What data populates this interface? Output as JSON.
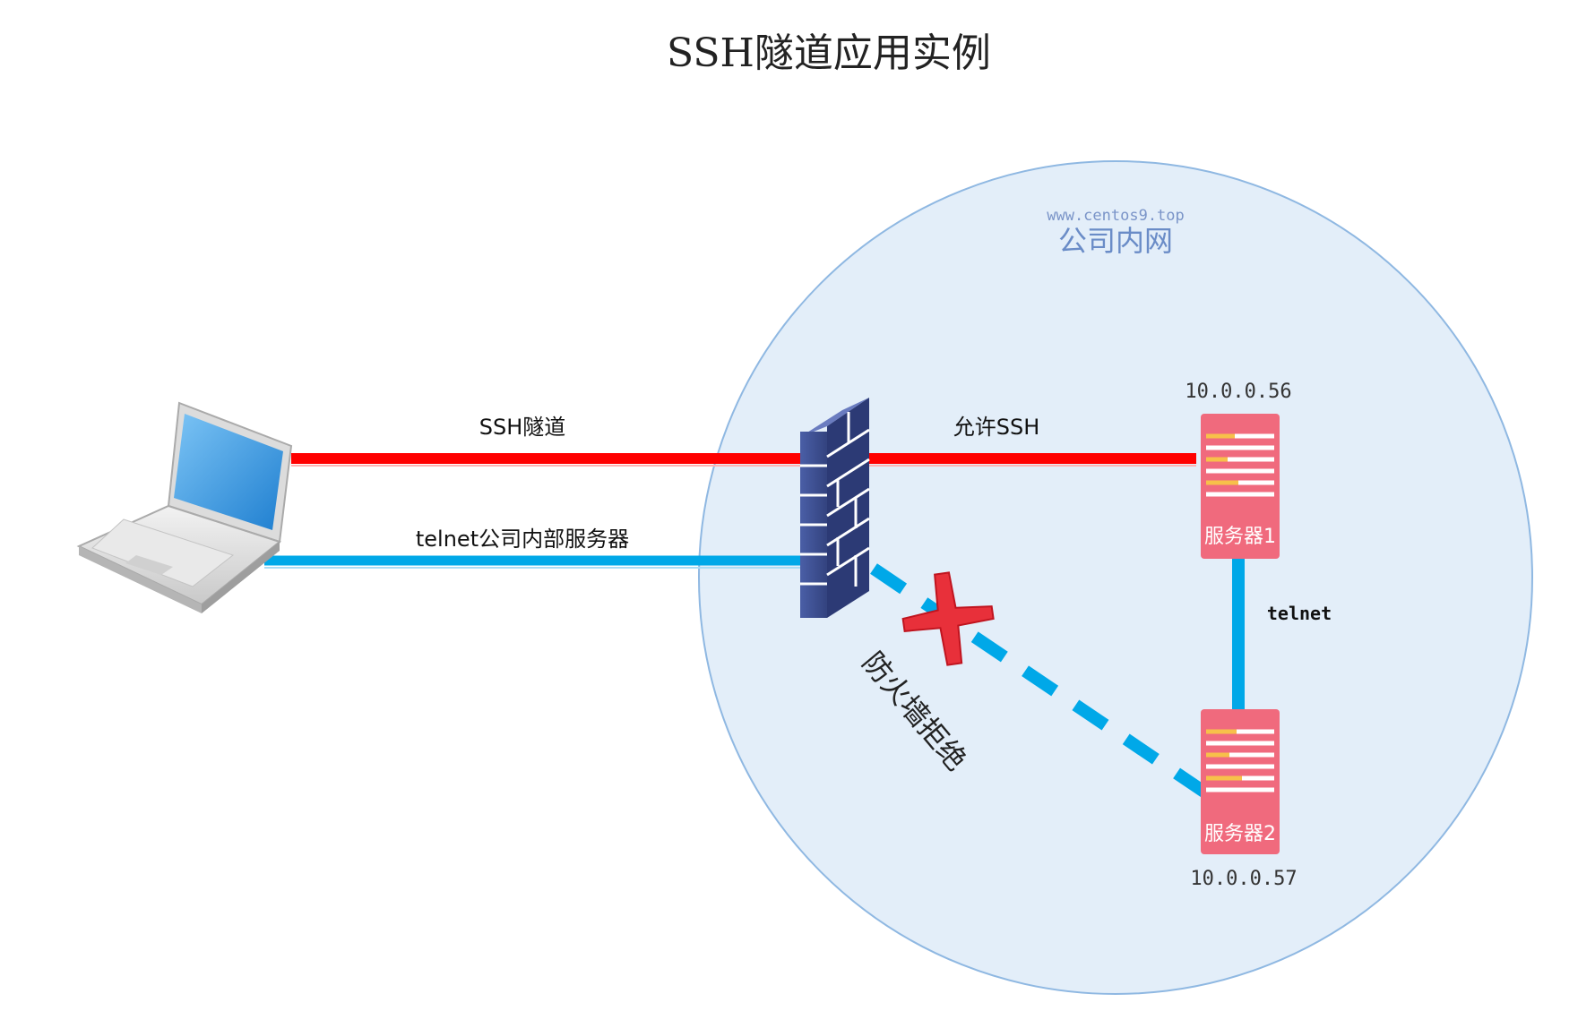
{
  "title": "SSH隧道应用实例",
  "network": {
    "watermark": "www.centos9.top",
    "label": "公司内网"
  },
  "links": {
    "ssh_tunnel": "SSH隧道",
    "allow_ssh": "允许SSH",
    "telnet_internal": "telnet公司内部服务器",
    "telnet_servers": "telnet",
    "firewall_reject": "防火墙拒绝"
  },
  "servers": [
    {
      "name": "服务器1",
      "ip": "10.0.0.56"
    },
    {
      "name": "服务器2",
      "ip": "10.0.0.57"
    }
  ],
  "colors": {
    "ssh_line": "#ff0000",
    "telnet_line": "#00a8e8",
    "network_fill": "#e3eef9",
    "network_stroke": "#8fb8e2",
    "server": "#f06a7d",
    "firewall": "#3a4a8c",
    "reject_mark": "#e8303a"
  },
  "icons": [
    "laptop-icon",
    "firewall-icon",
    "server-icon",
    "reject-cross-icon"
  ]
}
